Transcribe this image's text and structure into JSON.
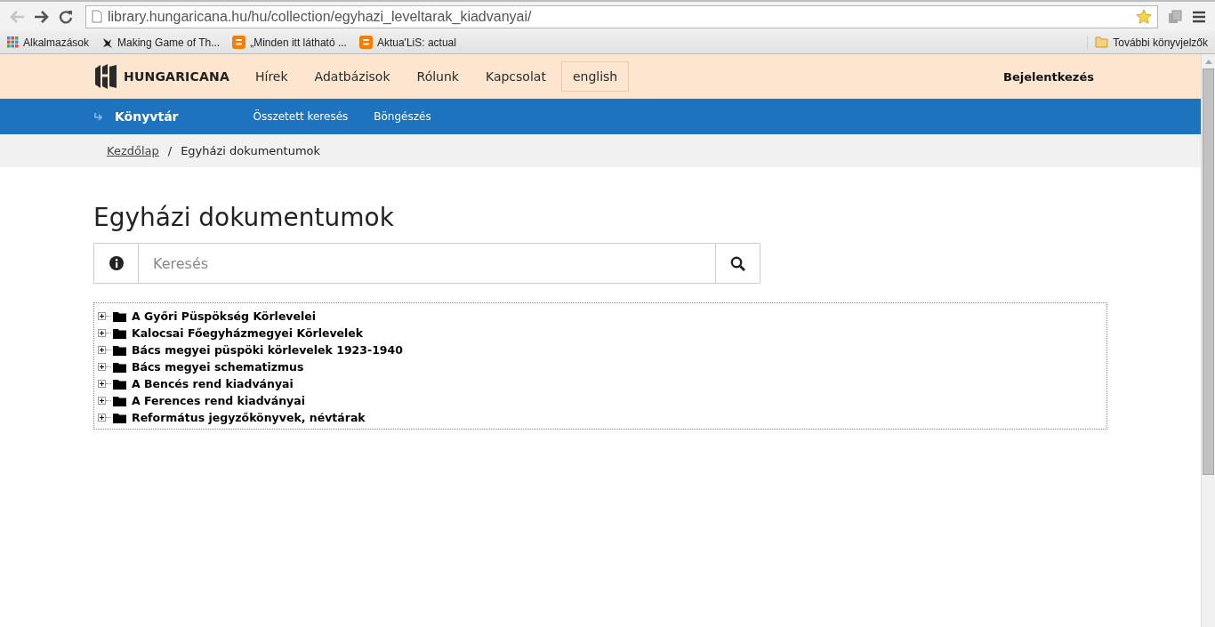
{
  "browser": {
    "url": "library.hungaricana.hu/hu/collection/egyhazi_leveltarak_kiadvanyai/",
    "bookmarks": [
      {
        "label": "Alkalmazások",
        "kind": "apps"
      },
      {
        "label": "Making Game of Th...",
        "kind": "pin"
      },
      {
        "label": "„Minden itt látható ...",
        "kind": "blog"
      },
      {
        "label": "Aktua'LiS: actual",
        "kind": "blog"
      }
    ],
    "other_bookmarks": "További könyvjelzők"
  },
  "header": {
    "logo": "HUNGARICANA",
    "nav": [
      {
        "label": "Hírek",
        "kind": "link"
      },
      {
        "label": "Adatbázisok",
        "kind": "link"
      },
      {
        "label": "Rólunk",
        "kind": "link"
      },
      {
        "label": "Kapcsolat",
        "kind": "link"
      },
      {
        "label": "english",
        "kind": "language"
      }
    ],
    "login": "Bejelentkezés"
  },
  "subnav": {
    "section": "Könyvtár",
    "links": [
      "Összetett keresés",
      "Böngészés"
    ]
  },
  "breadcrumb": {
    "separator": "/",
    "items": [
      {
        "label": "Kezdőlap",
        "link": true
      },
      {
        "label": "Egyházi dokumentumok",
        "link": false
      }
    ]
  },
  "title": "Egyházi dokumentumok",
  "search": {
    "placeholder": "Keresés"
  },
  "tree": [
    {
      "label": "A Győri Püspökség Körlevelei",
      "expanded": false
    },
    {
      "label": "Kalocsai Főegyházmegyei Körlevelek",
      "expanded": false
    },
    {
      "label": "Bács megyei püspöki körlevelek 1923-1940",
      "expanded": false
    },
    {
      "label": "Bács megyei schematizmus",
      "expanded": false
    },
    {
      "label": "A Bencés rend kiadványai",
      "expanded": false
    },
    {
      "label": "A Ferences rend kiadványai",
      "expanded": false
    },
    {
      "label": "Református jegyzőkönyvek, névtárak",
      "expanded": false
    }
  ]
}
